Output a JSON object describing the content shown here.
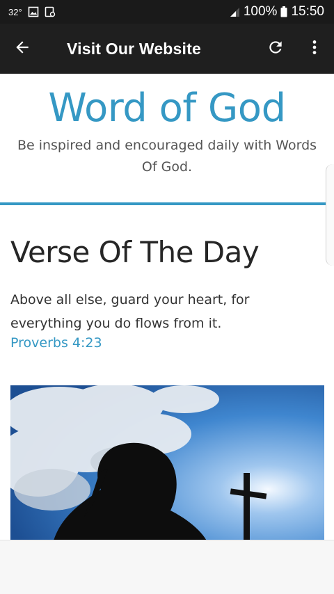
{
  "status_bar": {
    "temperature": "32°",
    "battery": "100%",
    "time": "15:50",
    "icons": [
      "image-icon",
      "notification-icon",
      "signal-icon",
      "battery-icon"
    ]
  },
  "toolbar": {
    "title": "Visit Our Website",
    "back_icon": "arrow-left-icon",
    "refresh_icon": "refresh-icon",
    "menu_icon": "more-vert-icon"
  },
  "site": {
    "title": "Word of God",
    "tagline": "Be inspired and encouraged daily with Words Of God."
  },
  "verse": {
    "heading": "Verse Of The Day",
    "text": "Above all else, guard your heart, for everything you do flows from it.",
    "reference": "Proverbs 4:23"
  },
  "colors": {
    "accent": "#3598c4",
    "toolbar_bg": "#1f1f1f",
    "status_bg": "#1a1a1a"
  }
}
